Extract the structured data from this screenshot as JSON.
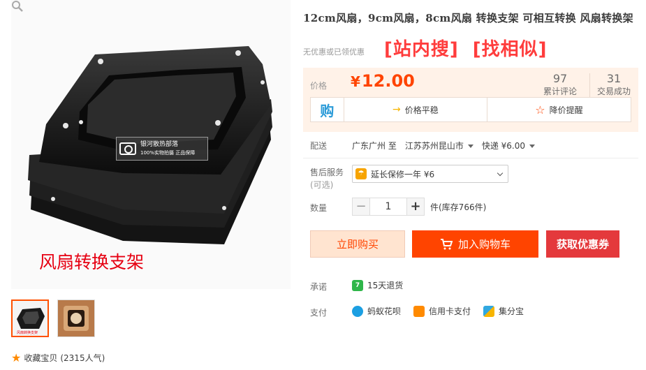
{
  "gallery": {
    "caption": "风扇转换支架",
    "watermark_line1": "银河散热部落",
    "watermark_line2": "100%实物拍摄 正品保障",
    "zoom_icon": "magnifier-icon",
    "thumbnails": [
      "thumb-black-bracket",
      "thumb-brown-bracket"
    ],
    "favorite_label": "收藏宝贝",
    "favorite_count": "(2315人气)"
  },
  "product": {
    "title": "12cm风扇，9cm风扇，8cm风扇 转换支架 可相互转换 风扇转换架",
    "no_coupon": "无优惠或已领优惠",
    "search_links": [
      "[站内搜]",
      "[找相似]"
    ]
  },
  "price": {
    "label": "价格",
    "currency": "¥",
    "value": "12.00",
    "reviews_count": "97",
    "reviews_label": "累计评论",
    "deals_count": "31",
    "deals_label": "交易成功",
    "buy_icon_text": "购",
    "trend_label": "价格平稳",
    "alert_label": "降价提醒"
  },
  "shipping": {
    "label": "配送",
    "from": "广东广州 至",
    "to": "江苏苏州昆山市",
    "method": "快递 ¥6.00"
  },
  "warranty": {
    "label": "售后服务",
    "optional": "(可选)",
    "option": "延长保修一年 ¥6"
  },
  "quantity": {
    "label": "数量",
    "value": "1",
    "minus": "−",
    "plus": "+",
    "stock": "件(库存766件)"
  },
  "actions": {
    "buy_now": "立即购买",
    "add_cart": "加入购物车",
    "coupon": "获取优惠券"
  },
  "promise": {
    "label": "承诺",
    "item": "15天退货",
    "icon_text": "7"
  },
  "payment": {
    "label": "支付",
    "methods": [
      "蚂蚁花呗",
      "信用卡支付",
      "集分宝"
    ]
  },
  "colors": {
    "accent": "#ff4400",
    "search_red": "#ff3c3c",
    "coupon_red": "#e4393c"
  }
}
